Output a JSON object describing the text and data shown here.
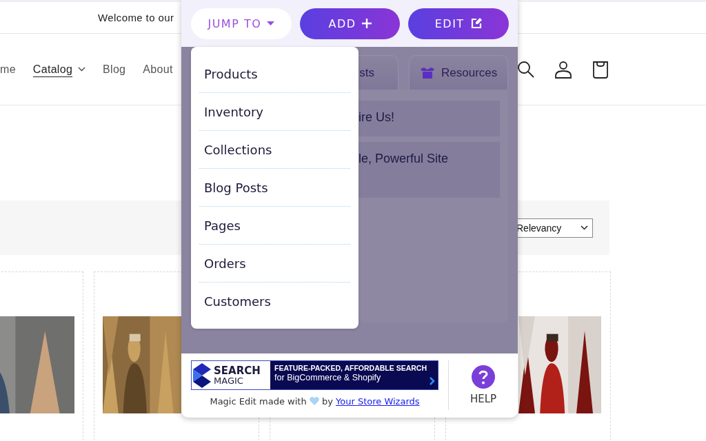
{
  "announcement": {
    "text": "Welcome to our"
  },
  "nav": [
    {
      "label": "me",
      "kind": "link",
      "selected": false
    },
    {
      "label": "Catalog",
      "kind": "dropdown",
      "selected": true
    },
    {
      "label": "Blog",
      "kind": "link",
      "selected": false
    },
    {
      "label": "About",
      "kind": "link",
      "selected": false
    }
  ],
  "sort": {
    "value": "Relevancy"
  },
  "magic_edit": {
    "buttons": [
      {
        "label": "JUMP TO",
        "kind": "dropdown"
      },
      {
        "label": "ADD",
        "kind": "add"
      },
      {
        "label": "EDIT",
        "kind": "edit"
      }
    ],
    "tabs": [
      {
        "label": "sts",
        "kind": "plain"
      },
      {
        "label": "Resources",
        "kind": "box"
      }
    ],
    "links": [
      "ire Us!",
      "le, Powerful Site"
    ],
    "jump_menu": [
      "Products",
      "Inventory",
      "Collections",
      "Blog Posts",
      "Pages",
      "Orders",
      "Customers"
    ],
    "ad": {
      "brand_1": "SEARCH",
      "brand_2": "MAGIC",
      "headline": "FEATURE-PACKED, AFFORDABLE SEARCH",
      "subline": "for BigCommerce & Shopify"
    },
    "credit": {
      "before": "Magic Edit made with",
      "after": "by",
      "link": "Your Store Wizards"
    },
    "help": "HELP"
  }
}
